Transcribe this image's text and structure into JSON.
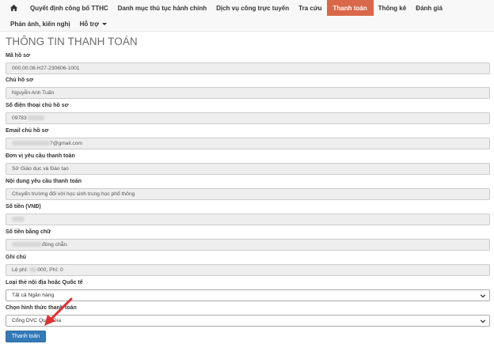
{
  "nav": {
    "row1": [
      {
        "label": "Quyết định công bố TTHC"
      },
      {
        "label": "Danh mục thủ tục hành chính"
      },
      {
        "label": "Dịch vụ công trực tuyến"
      },
      {
        "label": "Tra cứu"
      },
      {
        "label": "Thanh toán",
        "active": true
      },
      {
        "label": "Thống kê"
      },
      {
        "label": "Đánh giá"
      }
    ],
    "row2": [
      {
        "label": "Phản ánh, kiến nghị"
      },
      {
        "label": "Hỗ trợ"
      }
    ],
    "home_icon": "home-icon",
    "accent_color": "#d9684a"
  },
  "page": {
    "title": "THÔNG TIN THANH TOÁN"
  },
  "form": {
    "ma_ho_so": {
      "label": "Mã hồ sơ",
      "value": "000.00.08.H27-230606-1001"
    },
    "chu_ho_so": {
      "label": "Chủ hồ sơ",
      "value": "Nguyễn Anh Tuấn"
    },
    "so_dien_thoai": {
      "label": "Số điện thoại chủ hồ sơ",
      "value": "09783"
    },
    "email": {
      "label": "Email chủ hồ sơ",
      "value": "7@gmail.com"
    },
    "don_vi": {
      "label": "Đơn vị yêu cầu thanh toán",
      "value": "Sở Giáo dục và Đào tạo"
    },
    "noi_dung": {
      "label": "Nội dung yêu cầu thanh toán",
      "value": "Chuyển trường đối với học sinh trung học phổ thông"
    },
    "so_tien": {
      "label": "Số tiền (VNĐ)",
      "value": ""
    },
    "so_tien_chu": {
      "label": "Số tiền bằng chữ",
      "value": "đồng chẵn."
    },
    "ghi_chu": {
      "label": "Ghi chú",
      "value_prefix": "Lệ phí: ",
      "value_suffix": "000, Phí: 0"
    },
    "loai_the": {
      "label": "Loại thẻ nội địa hoặc Quốc tế",
      "selected": "Tất cả Ngân hàng"
    },
    "hinh_thuc": {
      "label": "Chọn hình thức thanh toán",
      "selected": "Cổng DVC Quốc Gia"
    },
    "submit_label": "Thanh toán",
    "button_color": "#337ab7",
    "annotation_color": "#e03030"
  }
}
